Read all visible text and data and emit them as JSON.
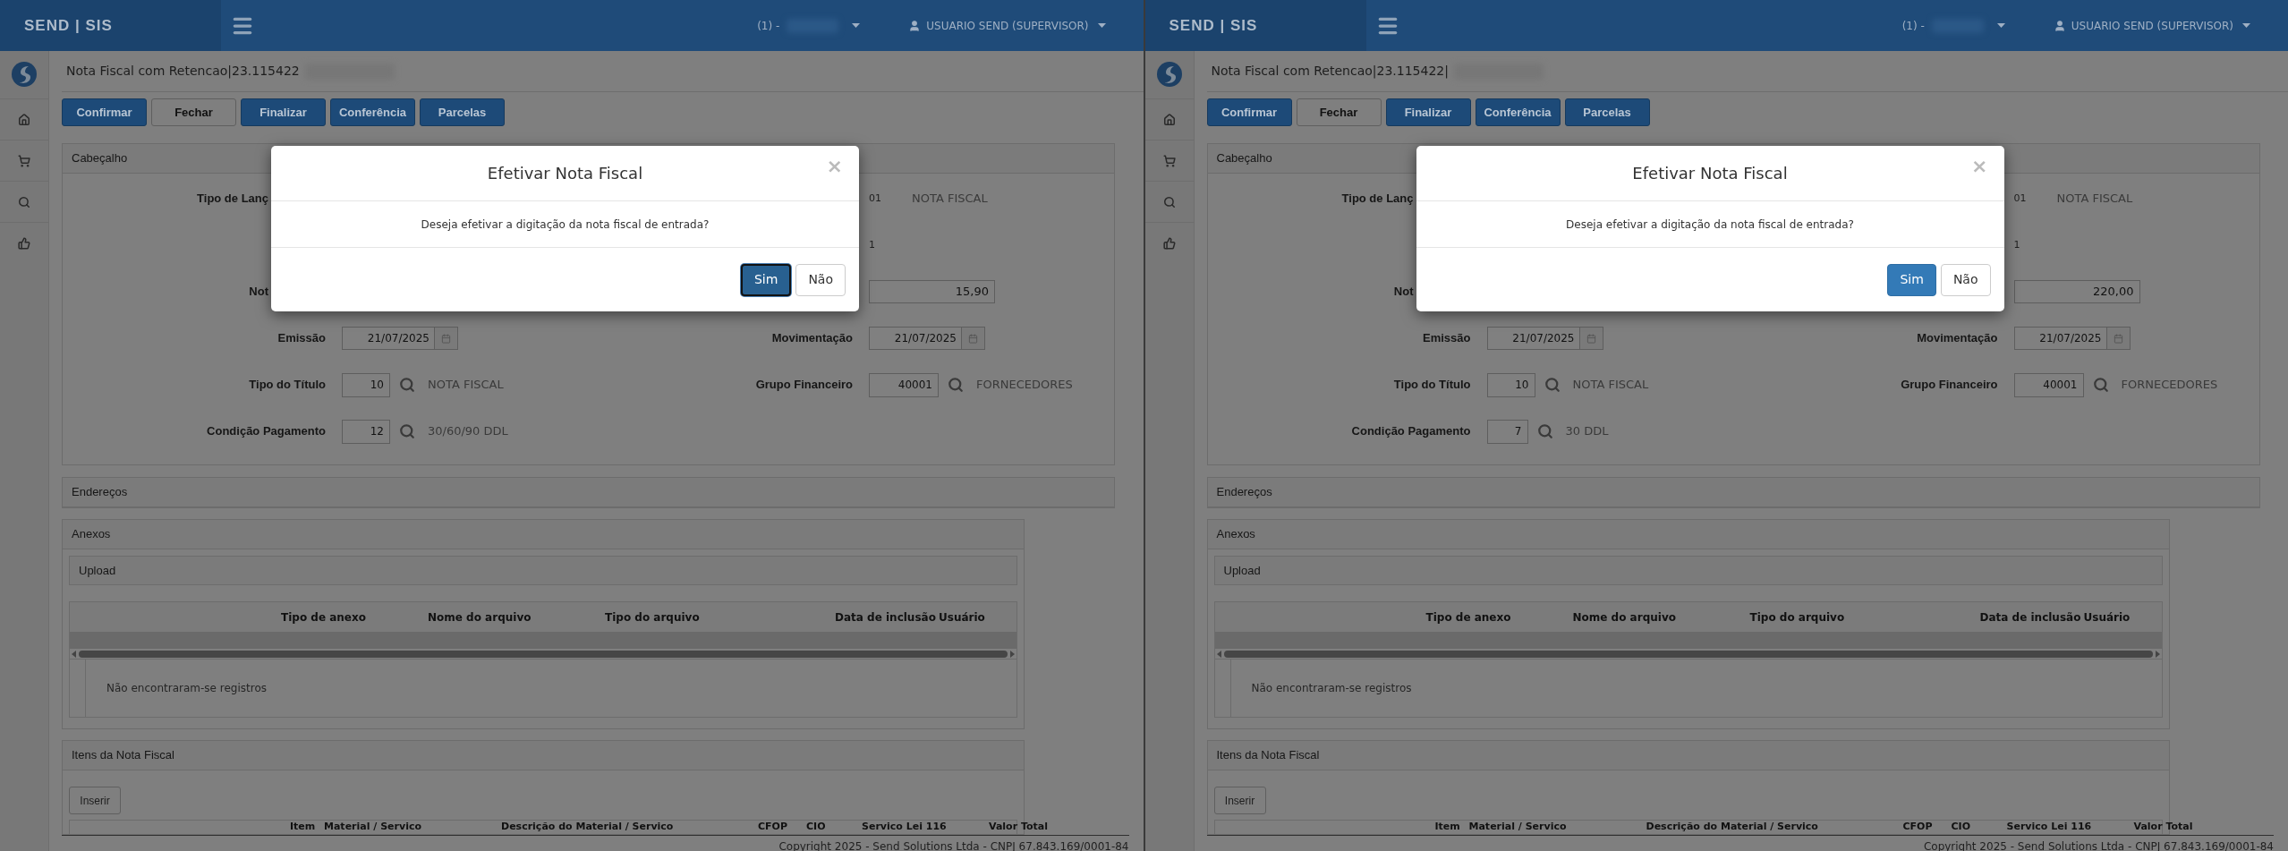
{
  "panes": [
    {
      "top_bar": {
        "brand": "SEND | SIS",
        "company": "(1) -",
        "user": "USUARIO SEND (SUPERVISOR)"
      },
      "page_title": "Nota Fiscal com Retencao|23.115422",
      "toolbar": [
        {
          "label": "Confirmar",
          "kind": "primary"
        },
        {
          "label": "Fechar",
          "kind": "default"
        },
        {
          "label": "Finalizar",
          "kind": "primary"
        },
        {
          "label": "Conferência",
          "kind": "primary"
        },
        {
          "label": "Parcelas",
          "kind": "primary"
        }
      ],
      "header_section": {
        "title": "Cabeçalho",
        "rows": [
          {
            "left": {
              "kind": "cut",
              "label": "Tipo de Lanç"
            },
            "right": {
              "kind": "code",
              "code": "01",
              "description": "NOTA FISCAL"
            }
          },
          {
            "right": {
              "kind": "code",
              "code": "1"
            }
          },
          {
            "left": {
              "kind": "cut",
              "label": "Not"
            },
            "right": {
              "kind": "input",
              "value": "15,90"
            }
          },
          {
            "left": {
              "kind": "date",
              "label": "Emissão",
              "value": "21/07/2025"
            },
            "right": {
              "kind": "date",
              "label": "Movimentação",
              "value": "21/07/2025"
            }
          },
          {
            "left": {
              "kind": "lookup",
              "label": "Tipo do Título",
              "value": "10",
              "description": "NOTA FISCAL"
            },
            "right": {
              "kind": "lookup",
              "label": "Grupo Financeiro",
              "value": "40001",
              "description": "FORNECEDORES"
            }
          },
          {
            "left": {
              "kind": "lookup",
              "label": "Condição Pagamento",
              "value": "12",
              "description": "30/60/90 DDL"
            }
          }
        ]
      },
      "addresses_section": {
        "title": "Endereços"
      },
      "attachments_section": {
        "title": "Anexos",
        "upload": "Upload",
        "columns": [
          "Tipo de anexo",
          "Nome do arquivo",
          "Tipo do arquivo",
          "Data de inclusão",
          "Usuário"
        ],
        "empty": "Não encontraram-se registros"
      },
      "items_section": {
        "title": "Itens da Nota Fiscal",
        "insert": "Inserir",
        "columns": [
          "Item",
          "Material / Servico",
          "Descrição do Material / Servico",
          "CFOP",
          "CIO",
          "Servico Lei 116",
          "Valor Total"
        ]
      },
      "footer": "Copyright 2025 - Send Solutions Ltda - CNPJ 67.843.169/0001-84",
      "modal": {
        "title": "Efetivar Nota Fiscal",
        "close": "×",
        "message": "Deseja efetivar a digitação da nota fiscal de entrada?",
        "buttons": [
          {
            "label": "Sim",
            "kind": "primary",
            "focused": true
          },
          {
            "label": "Não",
            "kind": "default",
            "focused": false
          }
        ]
      }
    },
    {
      "top_bar": {
        "brand": "SEND | SIS",
        "company": "(1) -",
        "user": "USUARIO SEND (SUPERVISOR)"
      },
      "page_title": "Nota Fiscal com Retencao|23.115422|",
      "toolbar": [
        {
          "label": "Confirmar",
          "kind": "primary"
        },
        {
          "label": "Fechar",
          "kind": "default"
        },
        {
          "label": "Finalizar",
          "kind": "primary"
        },
        {
          "label": "Conferência",
          "kind": "primary"
        },
        {
          "label": "Parcelas",
          "kind": "primary"
        }
      ],
      "header_section": {
        "title": "Cabeçalho",
        "rows": [
          {
            "left": {
              "kind": "cut",
              "label": "Tipo de Lanç"
            },
            "right": {
              "kind": "code",
              "code": "01",
              "description": "NOTA FISCAL"
            }
          },
          {
            "right": {
              "kind": "code",
              "code": "1"
            }
          },
          {
            "left": {
              "kind": "cut",
              "label": "Not"
            },
            "right": {
              "kind": "input",
              "value": "220,00"
            }
          },
          {
            "left": {
              "kind": "date",
              "label": "Emissão",
              "value": "21/07/2025"
            },
            "right": {
              "kind": "date",
              "label": "Movimentação",
              "value": "21/07/2025"
            }
          },
          {
            "left": {
              "kind": "lookup",
              "label": "Tipo do Título",
              "value": "10",
              "description": "NOTA FISCAL"
            },
            "right": {
              "kind": "lookup",
              "label": "Grupo Financeiro",
              "value": "40001",
              "description": "FORNECEDORES"
            }
          },
          {
            "left": {
              "kind": "lookup",
              "label": "Condição Pagamento",
              "value": "7",
              "description": "30 DDL"
            }
          }
        ]
      },
      "addresses_section": {
        "title": "Endereços"
      },
      "attachments_section": {
        "title": "Anexos",
        "upload": "Upload",
        "columns": [
          "Tipo de anexo",
          "Nome do arquivo",
          "Tipo do arquivo",
          "Data de inclusão",
          "Usuário"
        ],
        "empty": "Não encontraram-se registros"
      },
      "items_section": {
        "title": "Itens da Nota Fiscal",
        "insert": "Inserir",
        "columns": [
          "Item",
          "Material / Servico",
          "Descrição do Material / Servico",
          "CFOP",
          "CIO",
          "Servico Lei 116",
          "Valor Total"
        ]
      },
      "footer": "Copyright 2025 - Send Solutions Ltda - CNPJ 67.843.169/0001-84",
      "modal": {
        "title": "Efetivar Nota Fiscal",
        "close": "×",
        "message": "Deseja efetivar a digitação da nota fiscal de entrada?",
        "buttons": [
          {
            "label": "Sim",
            "kind": "primary",
            "focused": false
          },
          {
            "label": "Não",
            "kind": "default",
            "focused": false
          }
        ]
      }
    }
  ]
}
